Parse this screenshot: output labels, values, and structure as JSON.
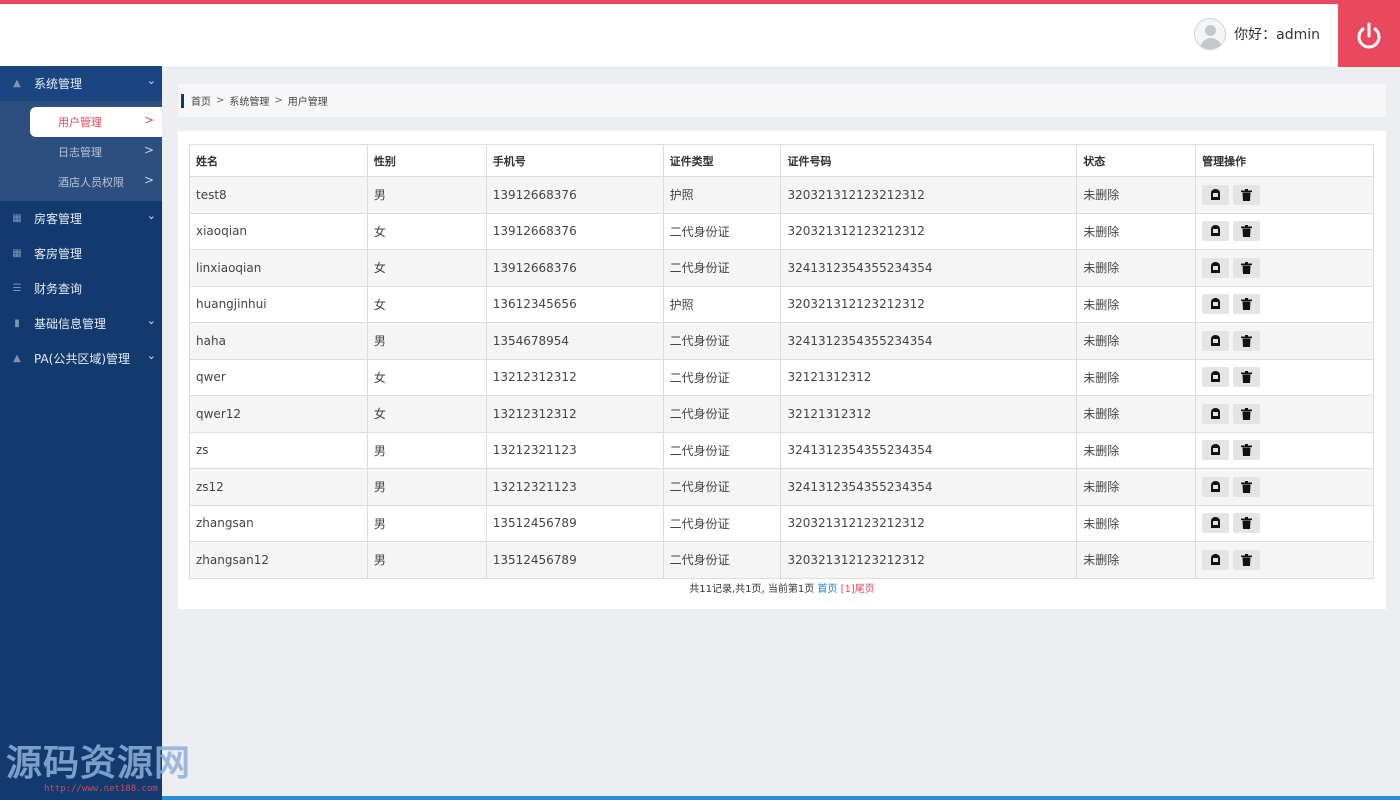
{
  "header": {
    "greeting": "你好：admin"
  },
  "sidebar": {
    "items": [
      {
        "label": "系统管理",
        "expanded": true,
        "children": [
          {
            "label": "用户管理",
            "active": true
          },
          {
            "label": "日志管理"
          },
          {
            "label": "酒店人员权限"
          }
        ]
      },
      {
        "label": "房客管理"
      },
      {
        "label": "客房管理"
      },
      {
        "label": "财务查询"
      },
      {
        "label": "基础信息管理"
      },
      {
        "label": "PA(公共区域)管理"
      }
    ],
    "arrow": ">"
  },
  "breadcrumb": [
    "首页",
    "系统管理",
    "用户管理"
  ],
  "breadcrumb_sep": ">",
  "table": {
    "headers": [
      "姓名",
      "性别",
      "手机号",
      "证件类型",
      "证件号码",
      "状态",
      "管理操作"
    ],
    "rows": [
      [
        "test8",
        "男",
        "13912668376",
        "护照",
        "320321312123212312",
        "未删除"
      ],
      [
        "xiaoqian",
        "女",
        "13912668376",
        "二代身份证",
        "320321312123212312",
        "未删除"
      ],
      [
        "linxiaoqian",
        "女",
        "13912668376",
        "二代身份证",
        "3241312354355234354",
        "未删除"
      ],
      [
        "huangjinhui",
        "女",
        "13612345656",
        "护照",
        "320321312123212312",
        "未删除"
      ],
      [
        "haha",
        "男",
        "1354678954",
        "二代身份证",
        "3241312354355234354",
        "未删除"
      ],
      [
        "qwer",
        "女",
        "13212312312",
        "二代身份证",
        "32121312312",
        "未删除"
      ],
      [
        "qwer12",
        "女",
        "13212312312",
        "二代身份证",
        "32121312312",
        "未删除"
      ],
      [
        "zs",
        "男",
        "13212321123",
        "二代身份证",
        "3241312354355234354",
        "未删除"
      ],
      [
        "zs12",
        "男",
        "13212321123",
        "二代身份证",
        "3241312354355234354",
        "未删除"
      ],
      [
        "zhangsan",
        "男",
        "13512456789",
        "二代身份证",
        "320321312123212312",
        "未删除"
      ],
      [
        "zhangsan12",
        "男",
        "13512456789",
        "二代身份证",
        "320321312123212312",
        "未删除"
      ]
    ]
  },
  "pager": {
    "summary": "共11记录,共1页, 当前第1页",
    "first": "首页",
    "current": "[1]",
    "last": "尾页"
  },
  "watermark": {
    "text": "源码资源网",
    "url": "http://www.net188.com"
  },
  "colors": {
    "accent": "#e8495e",
    "sidebar": "#123a6f",
    "link": "#1e7ec8"
  }
}
